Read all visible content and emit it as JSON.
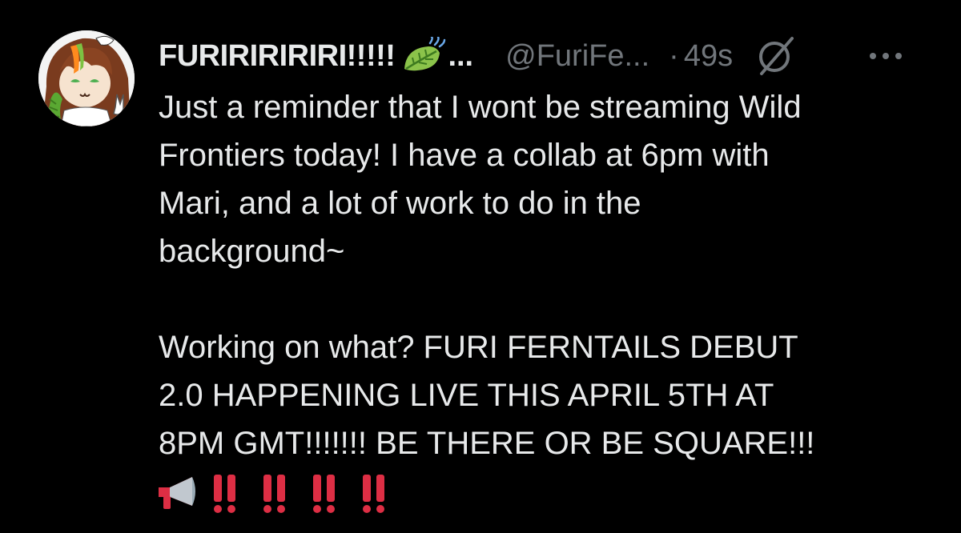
{
  "tweet": {
    "author": {
      "display_name": "FURIRIRIRIRI!!!!!",
      "name_ellipsis": "...",
      "handle": "@FuriFe...",
      "avatar_icon": "avatar-fox-girl-icon",
      "badge_icon": "slashed-circle-icon"
    },
    "separator": "·",
    "timestamp": "49s",
    "more_icon": "more-dots-icon",
    "text_lines_1": [
      "Just a reminder that I wont be streaming Wild",
      "Frontiers today! I have a collab at 6pm with",
      "Mari, and a lot of work to do in the",
      "background~"
    ],
    "text_lines_2": [
      "Working on what? FURI FERNTAILS DEBUT",
      "2.0 HAPPENING LIVE THIS APRIL 5TH AT",
      "8PM GMT!!!!!!! BE THERE OR BE SQUARE!!!"
    ],
    "emojis": [
      "megaphone-icon",
      "double-exclamation-icon",
      "double-exclamation-icon",
      "double-exclamation-icon",
      "double-exclamation-icon"
    ]
  },
  "colors": {
    "background": "#000000",
    "text_primary": "#e7e9ea",
    "text_secondary": "#71767b",
    "leaf_green": "#8bc34a",
    "exclamation_red": "#dd2e44"
  }
}
